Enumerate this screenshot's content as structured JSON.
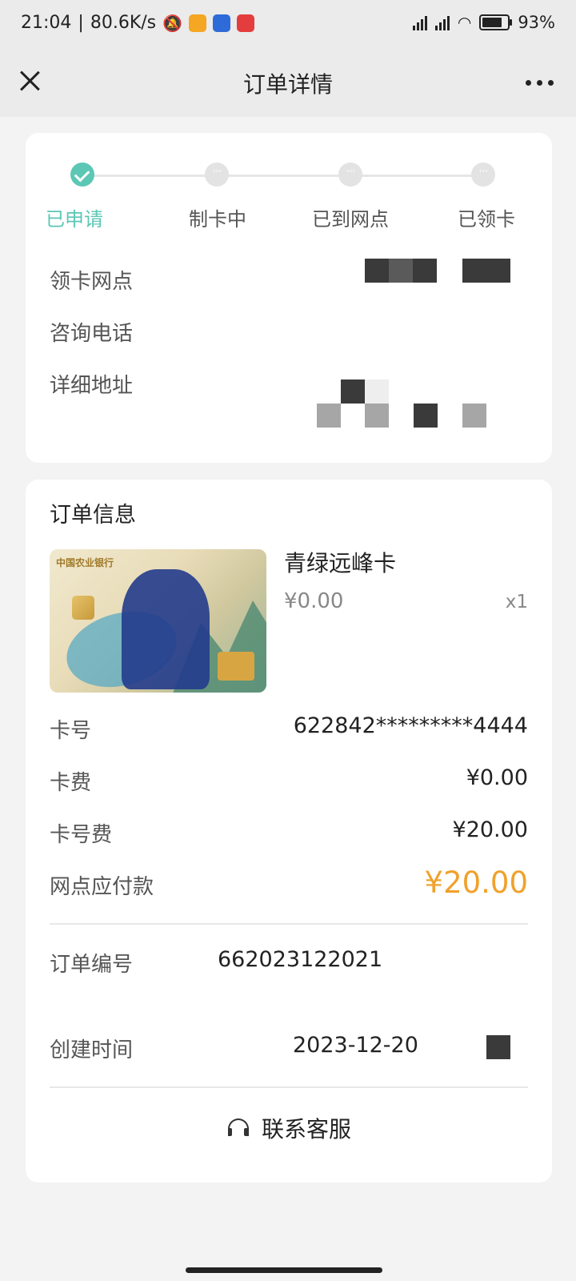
{
  "status_bar": {
    "time": "21:04",
    "network_speed": "80.6K/s",
    "battery_percent": "93%",
    "battery_level": 0.93,
    "app_icon_colors": [
      "#f5a623",
      "#2f6bd8",
      "#e43d3d"
    ]
  },
  "header": {
    "title": "订单详情",
    "close_icon": "close-icon",
    "more_icon": "more-dots-icon"
  },
  "progress": {
    "steps": [
      {
        "label": "已申请",
        "state": "done"
      },
      {
        "label": "制卡中",
        "state": "pending"
      },
      {
        "label": "已到网点",
        "state": "pending"
      },
      {
        "label": "已领卡",
        "state": "pending"
      }
    ],
    "accent_color": "#5cc7b5"
  },
  "branch": {
    "branch_label": "领卡网点",
    "phone_label": "咨询电话",
    "address_label": "详细地址"
  },
  "order": {
    "section_title": "订单信息",
    "product": {
      "name": "青绿远峰卡",
      "price": "¥0.00",
      "quantity": "x1",
      "card_bank_name": "中国农业银行"
    },
    "card_number_label": "卡号",
    "card_number": "622842*********4444",
    "card_fee_label": "卡费",
    "card_fee": "¥0.00",
    "number_fee_label": "卡号费",
    "number_fee": "¥20.00",
    "payable_label": "网点应付款",
    "payable": "¥20.00",
    "payable_color": "#f0a12c",
    "order_no_label": "订单编号",
    "order_no": "662023122021",
    "created_label": "创建时间",
    "created_time": "2023-12-20"
  },
  "service": {
    "label": "联系客服",
    "icon": "headset-icon"
  }
}
